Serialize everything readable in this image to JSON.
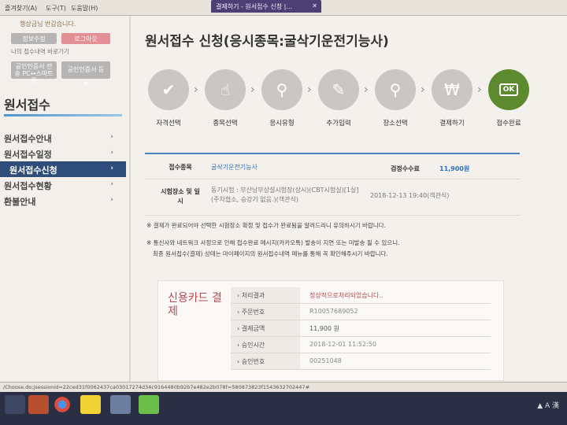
{
  "browser": {
    "menu": [
      "즐겨찾기(A)",
      "도구(T)",
      "도움말(H)"
    ],
    "popup_tab": "결제하기 - 원서접수 신청 |...",
    "status_url": "/Choose.do;jsessionid=22ced31f0062437ca03017274d34c9164480b92b7e482e2b078f=580873823f1543632702447#"
  },
  "sidebar": {
    "greeting": "행상금님 반갑습니다.",
    "buttons": [
      "정보수정",
      "로그아웃"
    ],
    "recent_link": "나의 접수내역 바로가기",
    "cert_buttons": [
      "공인인증서 전송 PC↔스마트폰",
      "공인인증서 등록"
    ],
    "title": "원서접수",
    "items": [
      {
        "label": "원서접수안내",
        "active": false
      },
      {
        "label": "원서접수일정",
        "active": false
      },
      {
        "label": "원서접수신청",
        "active": true
      },
      {
        "label": "원서접수현황",
        "active": false
      },
      {
        "label": "환불안내",
        "active": false
      }
    ]
  },
  "main": {
    "title": "원서접수 신청(응시종목:굴삭기운전기능사)",
    "steps": [
      {
        "label": "자격선택",
        "icon": "check-icon"
      },
      {
        "label": "종목선택",
        "icon": "pointer-icon"
      },
      {
        "label": "응시유형",
        "icon": "search-icon"
      },
      {
        "label": "추가입력",
        "icon": "pencil-icon"
      },
      {
        "label": "장소선택",
        "icon": "location-pin-icon"
      },
      {
        "label": "결제하기",
        "icon": "coin-icon"
      },
      {
        "label": "접수완료",
        "icon": "ok-icon",
        "icon_text": "OK",
        "current": true
      }
    ],
    "info": {
      "exam_item_label": "접수종목",
      "exam_item_value": "굴삭기운전기능사",
      "fee_label": "검정수수료",
      "fee_value": "11,900원",
      "place_label": "시험장소 및 일시",
      "place_value": "동기시험 : 부산남부상설시험장(상시)(CBT시험실)[1실]",
      "place_sub": "(주차협소, 승강기 없음.)(객관식)",
      "date_value": "2018-12-13 19:40(객관식)"
    },
    "notes": [
      "※ 결제가 완료되어야 선택한 시험장소 확정 및 접수가 완료됨을 알려드리니 유의하시기 바랍니다.",
      "※ 통신사와 네트워크 사정으로 인해 접수완료 메시지(카카오톡) 발송이 지연 또는 미발송 될 수 있으니.",
      "최종 원서접수(결제) 상태는 마이페이지의 원서접수내역 메뉴를 통해 꼭 확인해주시기 바랍니다."
    ],
    "payment": {
      "title": "신용카드 결제",
      "rows": [
        {
          "key": "처리결과",
          "value": "정상적으로처리되었습니다.."
        },
        {
          "key": "주문번호",
          "value": "R10057689052"
        },
        {
          "key": "결제금액",
          "value": "11,900 원"
        },
        {
          "key": "승인시간",
          "value": "2018-12-01 11:52:50"
        },
        {
          "key": "승인번호",
          "value": "00251048"
        }
      ]
    }
  },
  "taskbar": {
    "tray": "▲ A 漢"
  },
  "colors": {
    "accent": "#2e4d7a",
    "step_done": "#5d8a2e",
    "step_todo": "#c9c6c3",
    "payment_title": "#b54a55"
  }
}
